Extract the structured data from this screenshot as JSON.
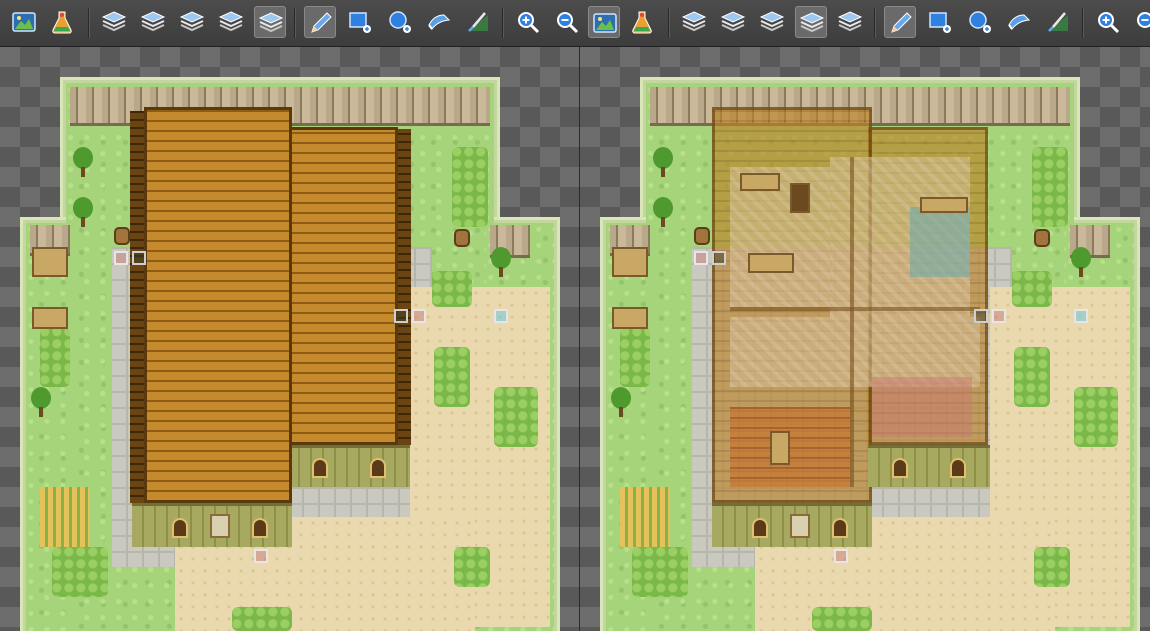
{
  "toolbar": {
    "left": {
      "buttons": [
        {
          "id": "map-properties",
          "icon": "map-landscape-icon",
          "active": false
        },
        {
          "id": "event-editor",
          "icon": "event-flask-icon",
          "active": false
        },
        {
          "id": "layer-1",
          "icon": "layers-stack-icon",
          "active": false
        },
        {
          "id": "layer-2",
          "icon": "layers-stack-icon",
          "active": false
        },
        {
          "id": "layer-3",
          "icon": "layers-stack-icon",
          "active": false
        },
        {
          "id": "layer-4",
          "icon": "layers-stack-icon",
          "active": false
        },
        {
          "id": "layer-auto",
          "icon": "layers-stack-icon",
          "active": true
        },
        {
          "id": "pencil",
          "icon": "pencil-icon",
          "active": true
        },
        {
          "id": "rectangle",
          "icon": "rectangle-tool-icon",
          "active": false
        },
        {
          "id": "ellipse",
          "icon": "ellipse-tool-icon",
          "active": false
        },
        {
          "id": "fill",
          "icon": "flood-fill-icon",
          "active": false
        },
        {
          "id": "shadow-pen",
          "icon": "shadow-pen-icon",
          "active": false
        },
        {
          "id": "zoom-in",
          "icon": "zoom-in-icon",
          "active": false
        },
        {
          "id": "zoom-out",
          "icon": "zoom-out-icon",
          "active": false
        }
      ]
    },
    "right": {
      "buttons": [
        {
          "id": "map-properties",
          "icon": "map-landscape-icon",
          "active": true
        },
        {
          "id": "event-editor",
          "icon": "event-flask-icon",
          "active": false
        },
        {
          "id": "layer-1",
          "icon": "layers-stack-icon",
          "active": false
        },
        {
          "id": "layer-2",
          "icon": "layers-stack-icon",
          "active": false
        },
        {
          "id": "layer-3",
          "icon": "layers-stack-icon",
          "active": false
        },
        {
          "id": "layer-4",
          "icon": "layers-stack-icon",
          "active": true
        },
        {
          "id": "layer-auto",
          "icon": "layers-stack-icon",
          "active": false
        },
        {
          "id": "pencil",
          "icon": "pencil-icon",
          "active": true
        },
        {
          "id": "rectangle",
          "icon": "rectangle-tool-icon",
          "active": false
        },
        {
          "id": "ellipse",
          "icon": "ellipse-tool-icon",
          "active": false
        },
        {
          "id": "fill",
          "icon": "flood-fill-icon",
          "active": false
        },
        {
          "id": "shadow-pen",
          "icon": "shadow-pen-icon",
          "active": false
        },
        {
          "id": "zoom-in",
          "icon": "zoom-in-icon",
          "active": false
        },
        {
          "id": "zoom-out",
          "icon": "zoom-out-icon",
          "active": false
        }
      ]
    }
  },
  "colors": {
    "grass": "#a6d47a",
    "roof": "#b07a22",
    "wall": "#9ea057",
    "sand": "#ead9ae",
    "accent_blue": "#3a8ee6"
  },
  "panes": {
    "left": {
      "view": "roof-visible"
    },
    "right": {
      "view": "interior-visible"
    }
  }
}
